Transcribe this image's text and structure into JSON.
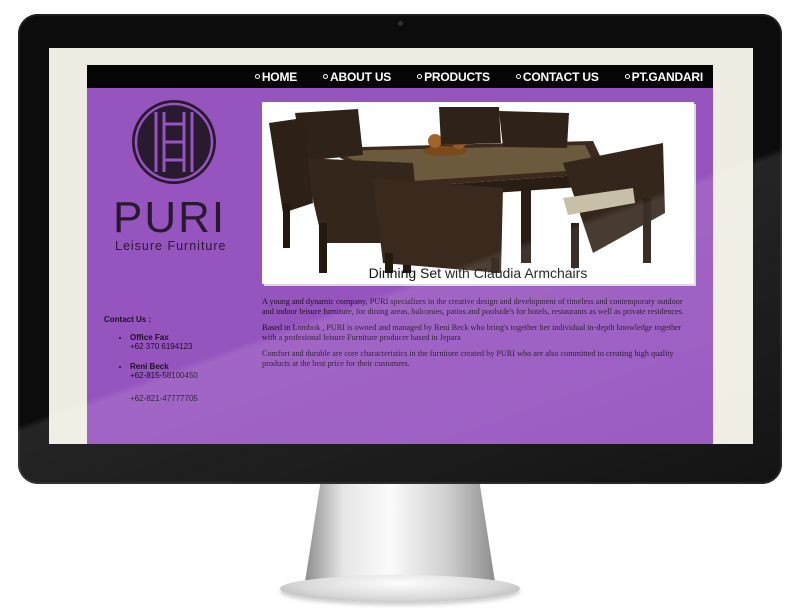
{
  "nav": {
    "items": [
      {
        "label": "HOME"
      },
      {
        "label": "ABOUT US"
      },
      {
        "label": "PRODUCTS"
      },
      {
        "label": "CONTACT US"
      },
      {
        "label": "PT.GANDARI"
      }
    ]
  },
  "logo": {
    "word": "PURI",
    "tagline": "Leisure Furniture"
  },
  "photo": {
    "caption": "Dinning Set with Claudia Armchairs"
  },
  "contact": {
    "title": "Contact Us :",
    "entries": [
      {
        "name": "Office Fax",
        "lines": [
          "+62 370 6194123"
        ]
      },
      {
        "name": "Reni Beck",
        "lines": [
          "+62-815-58100450",
          "+62-821-47777705"
        ]
      }
    ]
  },
  "about": {
    "paragraphs": [
      "A young and dynamic company, PURI specializes in the creative design and development of timeless and contemporary outdoor and indoor leisure furniture, for dining areas, balconies, patios and poolside's for hotels, restaurants as well as private residences.",
      "Based in Lombok , PURI is owned and managed by Reni Beck who bring's together her individual in-depth knowledge together with a profesional leisure Furniture producer based in Jepara",
      "Comfort and durable are core characteristics in the furniture created by PURI who are also committed to creating high quality products at the best price for their customers."
    ]
  },
  "colors": {
    "page_bg": "#9654bf",
    "nav_bg": "#050505",
    "screen_margin": "#efede3"
  }
}
